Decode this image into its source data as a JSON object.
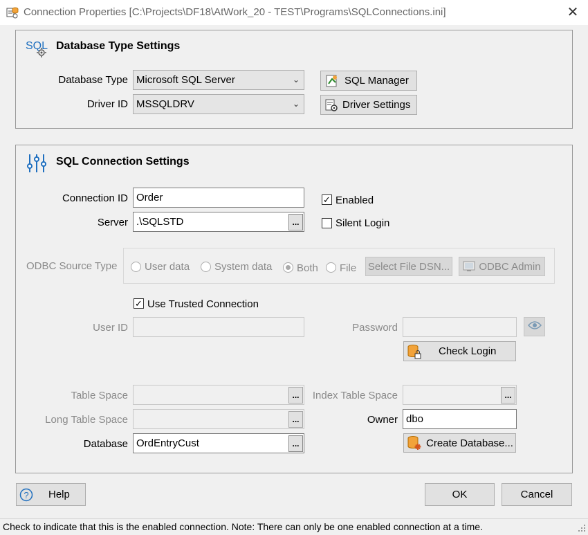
{
  "window": {
    "title": "Connection Properties [C:\\Projects\\DF18\\AtWork_20 - TEST\\Programs\\SQLConnections.ini]"
  },
  "db_type": {
    "title": "Database Type Settings",
    "icon_text": "SQL",
    "database_type_label": "Database Type",
    "database_type_value": "Microsoft SQL Server",
    "driver_id_label": "Driver ID",
    "driver_id_value": "MSSQLDRV",
    "sql_manager_label": "SQL Manager",
    "driver_settings_label": "Driver Settings"
  },
  "conn": {
    "title": "SQL Connection Settings",
    "connection_id_label": "Connection ID",
    "connection_id_value": "Order",
    "server_label": "Server",
    "server_value": ".\\SQLSTD",
    "enabled_label": "Enabled",
    "enabled_checked": true,
    "silent_login_label": "Silent Login",
    "silent_login_checked": false,
    "odbc_label": "ODBC Source Type",
    "odbc_options": [
      "User data",
      "System data",
      "Both",
      "File"
    ],
    "odbc_selected": "Both",
    "select_file_dsn_label": "Select File DSN...",
    "odbc_admin_label": "ODBC Admin",
    "trusted_label": "Use Trusted Connection",
    "trusted_checked": true,
    "user_id_label": "User ID",
    "password_label": "Password",
    "check_login_label": "Check Login",
    "table_space_label": "Table Space",
    "index_table_space_label": "Index Table Space",
    "long_table_space_label": "Long Table Space",
    "owner_label": "Owner",
    "owner_value": "dbo",
    "database_label": "Database",
    "database_value": "OrdEntryCust",
    "create_database_label": "Create Database...",
    "ellipsis": "..."
  },
  "footer": {
    "help_label": "Help",
    "ok_label": "OK",
    "cancel_label": "Cancel"
  },
  "status": {
    "text": "Check to indicate that this is the enabled connection. Note: There can only be one enabled connection at a time."
  },
  "colors": {
    "accent_blue": "#1f6fbf",
    "db_orange": "#f2a33a",
    "disabled_text": "#8a8a8a"
  }
}
